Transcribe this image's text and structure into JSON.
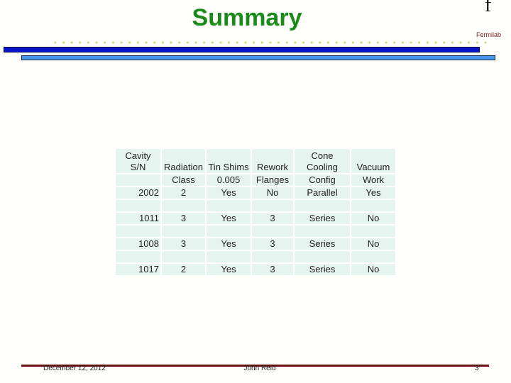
{
  "slide": {
    "title": "Summary",
    "logo_glyph": "f",
    "organization": "Fermilab",
    "colors": {
      "title": "#1a8a1a",
      "dots": "#c8d87a",
      "top_bar": "#0a14c8",
      "second_bar": "#4a96e8",
      "footer_line": "#6a1010",
      "cell_background": "#e6f4ef"
    }
  },
  "table": {
    "header_rows": [
      [
        "Cavity\nS/N",
        "Radiation",
        "Tin Shims",
        "Rework",
        "Cone\nCooling",
        "Vacuum"
      ],
      [
        "",
        "Class",
        "0.005",
        "Flanges",
        "Config",
        "Work"
      ]
    ],
    "columns": [
      "Cavity S/N",
      "Radiation Class",
      "Tin Shims 0.005",
      "Rework Flanges",
      "Cone Cooling Config",
      "Vacuum Work"
    ],
    "rows": [
      [
        "2002",
        "2",
        "Yes",
        "No",
        "Parallel",
        "Yes"
      ],
      [
        "1011",
        "3",
        "Yes",
        "3",
        "Series",
        "No"
      ],
      [
        "1008",
        "3",
        "Yes",
        "3",
        "Series",
        "No"
      ],
      [
        "1017",
        "2",
        "Yes",
        "3",
        "Series",
        "No"
      ]
    ]
  },
  "footer": {
    "date": "December 12, 2012",
    "author": "John Reid",
    "page": "3"
  }
}
